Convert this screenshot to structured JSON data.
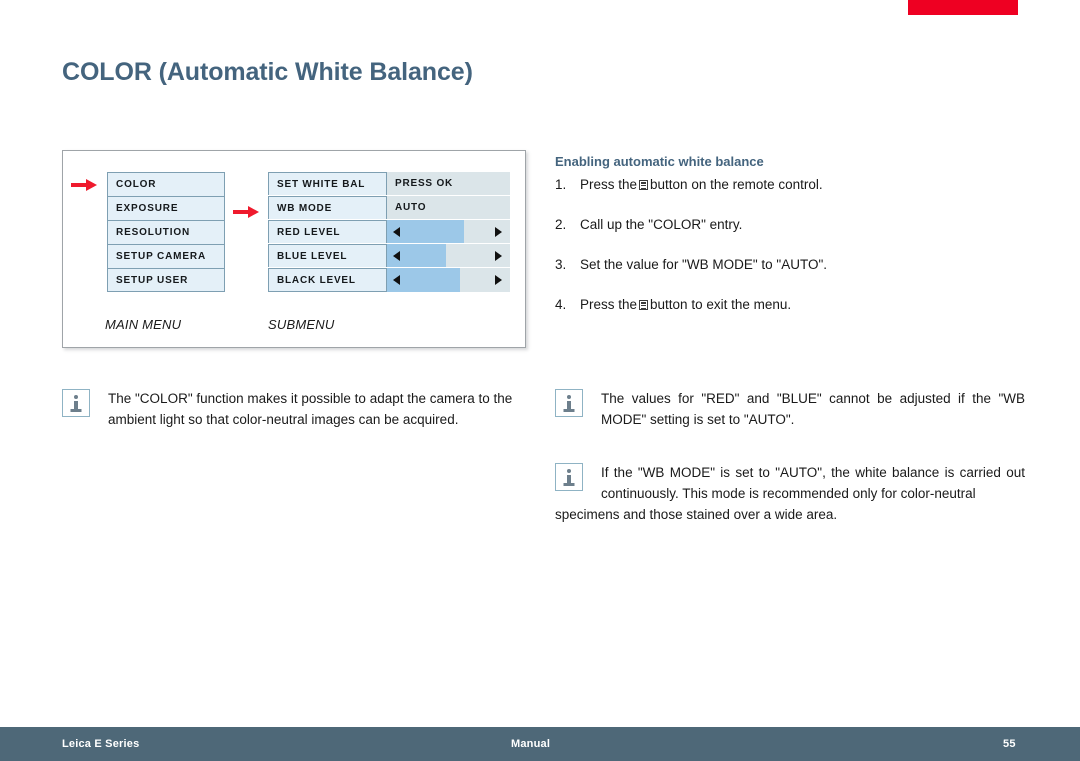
{
  "document": {
    "title": "COLOR (Automatic White Balance)"
  },
  "top_marker": {
    "color": "#ee0022"
  },
  "diagram": {
    "main_menu": {
      "caption": "MAIN MENU",
      "items": [
        {
          "label": "COLOR"
        },
        {
          "label": "EXPOSURE"
        },
        {
          "label": "RESOLUTION"
        },
        {
          "label": "SETUP CAMERA"
        },
        {
          "label": "SETUP USER"
        }
      ],
      "selected": "COLOR"
    },
    "submenu": {
      "caption": "SUBMENU",
      "rows": [
        {
          "label": "SET WHITE BAL",
          "type": "value",
          "value": "PRESS OK"
        },
        {
          "label": "WB MODE",
          "type": "value",
          "value": "AUTO"
        },
        {
          "label": "RED LEVEL",
          "type": "slider",
          "fill_percent": 63
        },
        {
          "label": "BLUE LEVEL",
          "type": "slider",
          "fill_percent": 48
        },
        {
          "label": "BLACK LEVEL",
          "type": "slider",
          "fill_percent": 59
        }
      ],
      "selected": "WB MODE"
    },
    "arrows": {
      "main_menu_pointer": "red-arrow-right",
      "submenu_pointer": "red-arrow-right",
      "color": "#ef1a2d"
    }
  },
  "instructions": {
    "heading": "Enabling automatic white balance",
    "steps": [
      {
        "number": "1.",
        "before_icon": "Press the",
        "icon": "menu-button-icon",
        "after_icon": "button on the remote control."
      },
      {
        "number": "2.",
        "before_icon": "Call up the \"COLOR\" entry.",
        "icon": null,
        "after_icon": ""
      },
      {
        "number": "3.",
        "before_icon": "Set the value for \"WB MODE\" to \"AUTO\".",
        "icon": null,
        "after_icon": ""
      },
      {
        "number": "4.",
        "before_icon": "Press the",
        "icon": "menu-button-icon",
        "after_icon": "button to exit the menu."
      }
    ]
  },
  "notes": {
    "left": {
      "icon": "info-icon",
      "text": "The \"COLOR\" function makes it possible to adapt the camera to the ambient light so that color-neutral images can be acquired."
    },
    "right_first": {
      "icon": "info-icon",
      "text": "The values for \"RED\" and \"BLUE\" cannot be adjusted if the \"WB MODE\" setting is set to \"AUTO\"."
    },
    "right_second": {
      "icon": "info-icon",
      "text": "If the \"WB MODE\" is set to \"AUTO\", the white balance is carried out continuously. This mode is recommended only for color-neutral",
      "overflow": "specimens and those stained over a wide area."
    }
  },
  "footer": {
    "left": "Leica E Series",
    "center": "Manual",
    "page": "55",
    "background": "#4e6878"
  }
}
